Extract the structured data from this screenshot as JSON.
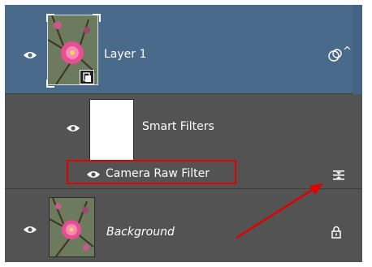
{
  "layers": {
    "layer1": {
      "name": "Layer 1",
      "expand_glyph": "^"
    },
    "smart_filters": {
      "name": "Smart Filters"
    },
    "camera_raw": {
      "name": "Camera Raw Filter"
    },
    "background": {
      "name": "Background"
    }
  },
  "colors": {
    "panel_bg": "#535353",
    "selected_row": "#4a6a8c",
    "highlight_box": "#e00000",
    "annotation_arrow": "#e00000"
  },
  "icons": {
    "visibility": "eye-icon",
    "smart_object_badge": "smart-object-icon",
    "smart_filter_link": "smart-filter-chain-icon",
    "blend_options": "filter-blending-options-icon",
    "lock": "lock-icon"
  }
}
